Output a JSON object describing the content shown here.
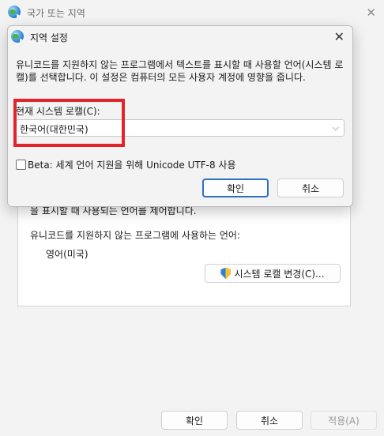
{
  "background_window": {
    "title": "국가 또는 지역",
    "close_glyph": "✕",
    "description_partial": "을 표시할 때 사용되는 언어를 제어합니다.",
    "non_unicode_label": "유니코드를 지원하지 않는 프로그램에 사용하는 언어:",
    "current_language": "영어(미국)",
    "change_locale_button": "시스템 로캘 변경(C)...",
    "ok_button": "확인",
    "cancel_button": "취소",
    "apply_button": "적용(A)"
  },
  "dialog": {
    "title": "지역 설정",
    "close_glyph": "✕",
    "description": "유니코드를 지원하지 않는 프로그램에서 텍스트를 표시할 때 사용할 언어(시스템 로캘)를 선택합니다. 이 설정은 컴퓨터의 모든 사용자 계정에 영향을 줍니다.",
    "locale_label": "현재 시스템 로캘(C):",
    "locale_value": "한국어(대한민국)",
    "chevron_glyph": "⌵",
    "beta_checkbox_label": "Beta: 세계 언어 지원을 위해 Unicode UTF-8 사용",
    "beta_checked": false,
    "ok_button": "확인",
    "cancel_button": "취소"
  },
  "icons": {
    "globe": "globe-icon",
    "shield": "uac-shield-icon",
    "close": "close-icon",
    "chevron": "chevron-down-icon",
    "checkbox": "checkbox-icon"
  },
  "colors": {
    "highlight": "#e3242b",
    "primary_button_border": "#2f6fbf"
  }
}
